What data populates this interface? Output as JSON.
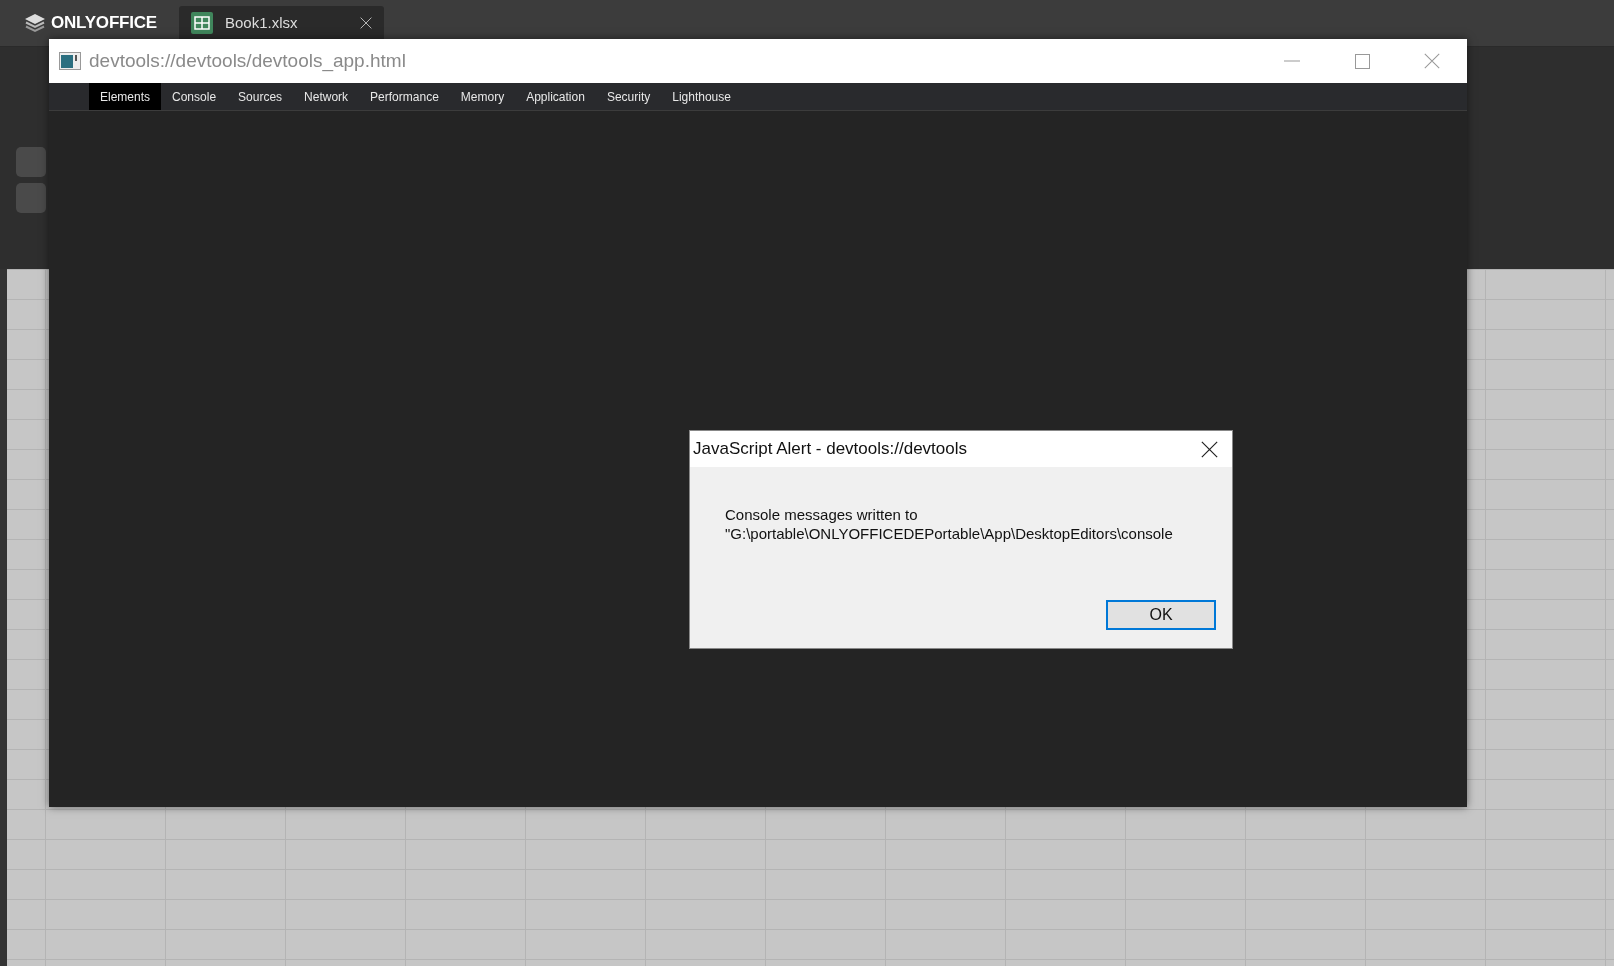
{
  "app": {
    "logo": "ONLYOFFICE",
    "tabs": [
      {
        "label": "Book1.xlsx",
        "selected": true
      }
    ]
  },
  "devtools_window": {
    "title": "devtools://devtools/devtools_app.html",
    "tabs": [
      {
        "label": "Elements",
        "selected": true
      },
      {
        "label": "Console",
        "selected": false
      },
      {
        "label": "Sources",
        "selected": false
      },
      {
        "label": "Network",
        "selected": false
      },
      {
        "label": "Performance",
        "selected": false
      },
      {
        "label": "Memory",
        "selected": false
      },
      {
        "label": "Application",
        "selected": false
      },
      {
        "label": "Security",
        "selected": false
      },
      {
        "label": "Lighthouse",
        "selected": false
      }
    ]
  },
  "alert": {
    "title": "JavaScript Alert - devtools://devtools",
    "message": [
      "Console messages written to",
      "\"G:\\portable\\ONLYOFFICEDEPortable\\App\\DesktopEditors\\console"
    ],
    "buttons": [
      "OK"
    ]
  }
}
